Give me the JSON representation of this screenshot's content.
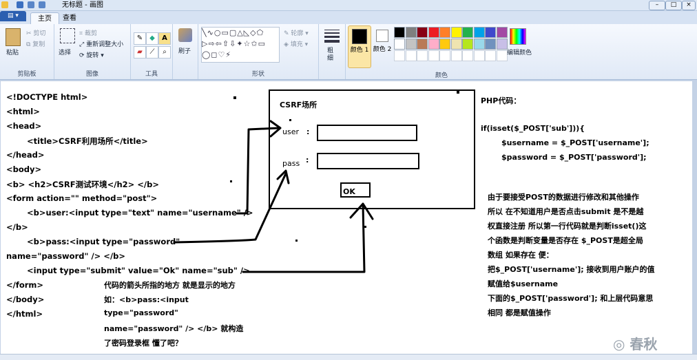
{
  "window": {
    "title": "无标题 - 画图"
  },
  "tabs": {
    "home": "主页",
    "view": "查看"
  },
  "ribbon": {
    "clipboard": {
      "paste": "粘贴",
      "cut": "剪切",
      "copy": "复制",
      "group": "剪贴板"
    },
    "image": {
      "select": "选择",
      "crop": "裁剪",
      "resize": "重新调整大小",
      "rotate": "旋转",
      "group": "图像"
    },
    "tools": {
      "group": "工具"
    },
    "brushes": {
      "label": "刷子"
    },
    "shapes": {
      "outline": "轮廓",
      "fill": "填充",
      "group": "形状"
    },
    "size": {
      "label": "粗细"
    },
    "color1": {
      "label": "颜色 1"
    },
    "color2": {
      "label": "颜色 2"
    },
    "colors": {
      "group": "颜色",
      "edit": "编辑颜色"
    },
    "palette": [
      "#000000",
      "#7f7f7f",
      "#880015",
      "#ed1c24",
      "#ff7f27",
      "#fff200",
      "#22b14c",
      "#00a2e8",
      "#3f48cc",
      "#a349a4",
      "#ffffff",
      "#c3c3c3",
      "#b97a57",
      "#ffaec9",
      "#ffc90e",
      "#efe4b0",
      "#b5e61d",
      "#99d9ea",
      "#7092be",
      "#c8bfe7"
    ]
  },
  "canvas": {
    "code_lines": [
      "<!DOCTYPE html>",
      "<html>",
      "<head>",
      "<title>CSRF利用场所</title>",
      "</head>",
      "<body>",
      "<b> <h2>CSRF测试环境</h2> </b>",
      "<form action=\"\" method=\"post\">",
      "<b>user:<input type=\"text\" name=\"username\" />",
      "</b>",
      "<b>pass:<input type=\"password\"",
      "name=\"password\" /> </b>",
      "<input type=\"submit\" value=\"Ok\" name=\"sub\" />",
      "</form>",
      "</body>",
      "</html>"
    ],
    "note_lines": [
      "代码的箭头所指的地方 就是显示的地方",
      "如：<b>pass:<input",
      "type=\"password\"",
      "name=\"password\" /> </b>   就构造",
      "了密码登录框 懂了吧？"
    ],
    "form": {
      "title": "CSRF场所",
      "user_label": "user",
      "pass_label": "pass",
      "colon": ":",
      "ok": "OK"
    },
    "php_title": "PHP代码：",
    "php_lines": [
      "if(isset($_POST['sub'])){",
      "$username = $_POST['username'];",
      "$password = $_POST['password'];"
    ],
    "explain_lines": [
      "由于要接受POST的数据进行修改和其他操作",
      "所以 在不知道用户是否点击submit 是不是越",
      "权直接注册 所以第一行代码就是判断isset()这",
      "个函数是判断变量是否存在 $_POST是超全局",
      "数组 如果存在 便：",
      "把$_POST['username']; 接收到用户账户的值",
      "赋值给$username",
      "下面的$_POST['password']; 和上层代码意思",
      "相同 都是赋值操作"
    ]
  }
}
